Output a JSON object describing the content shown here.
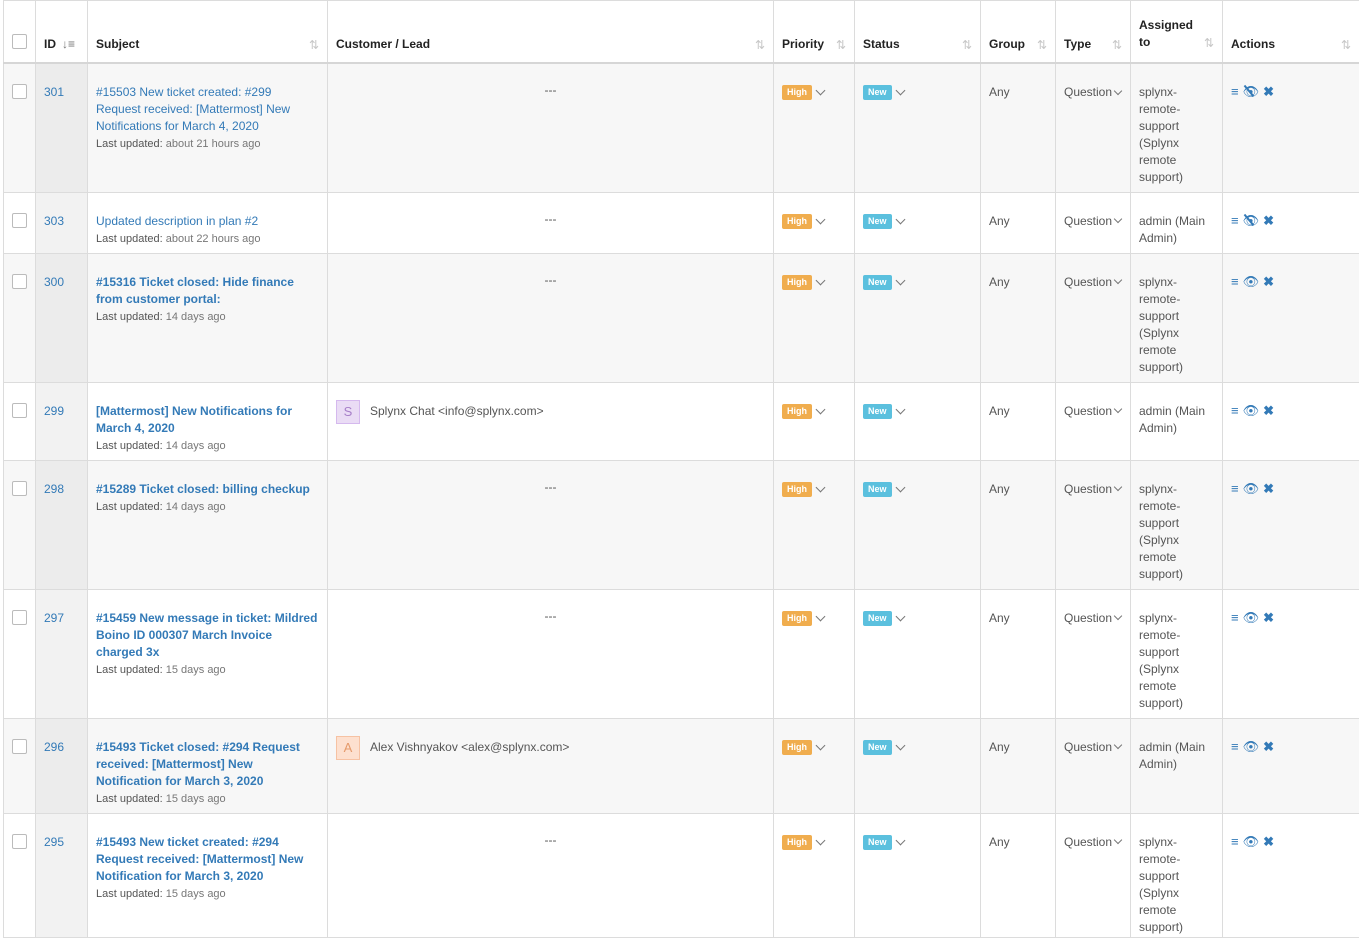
{
  "columns": {
    "id": "ID",
    "subject": "Subject",
    "customer": "Customer / Lead",
    "priority": "Priority",
    "status": "Status",
    "group": "Group",
    "type": "Type",
    "assigned": "Assigned to",
    "actions": "Actions"
  },
  "labels": {
    "last_updated": "Last updated:",
    "empty_customer": "---"
  },
  "rows": [
    {
      "id": "301",
      "subject": "#15503 New ticket created: #299 Request received: [Mattermost] New Notifications for March 4, 2020",
      "bold": false,
      "updated": "about 21 hours ago",
      "customer": null,
      "priority": "High",
      "status": "New",
      "group": "Any",
      "type": "Question",
      "assigned": "splynx-remote-support (Splynx remote support)",
      "view_icon": "eye-slash-icon"
    },
    {
      "id": "303",
      "subject": "Updated description in plan #2",
      "bold": false,
      "updated": "about 22 hours ago",
      "customer": null,
      "priority": "High",
      "status": "New",
      "group": "Any",
      "type": "Question",
      "assigned": "admin (Main Admin)",
      "view_icon": "eye-slash-icon"
    },
    {
      "id": "300",
      "subject": "#15316 Ticket closed: Hide finance from customer portal:",
      "bold": true,
      "updated": "14 days ago",
      "customer": null,
      "priority": "High",
      "status": "New",
      "group": "Any",
      "type": "Question",
      "assigned": "splynx-remote-support (Splynx remote support)",
      "view_icon": "eye-icon"
    },
    {
      "id": "299",
      "subject": "[Mattermost] New Notifications for March 4, 2020",
      "bold": true,
      "updated": "14 days ago",
      "customer": {
        "initial": "S",
        "name": "Splynx Chat <info@splynx.com>",
        "bg": "#eadcf5",
        "border": "#d5b9ee",
        "color": "#a77fc9"
      },
      "priority": "High",
      "status": "New",
      "group": "Any",
      "type": "Question",
      "assigned": "admin (Main Admin)",
      "view_icon": "eye-icon"
    },
    {
      "id": "298",
      "subject": "#15289 Ticket closed: billing checkup",
      "bold": true,
      "updated": "14 days ago",
      "customer": null,
      "priority": "High",
      "status": "New",
      "group": "Any",
      "type": "Question",
      "assigned": "splynx-remote-support (Splynx remote support)",
      "view_icon": "eye-icon"
    },
    {
      "id": "297",
      "subject": "#15459 New message in ticket: Mildred Boino ID 000307 March Invoice charged 3x",
      "bold": true,
      "updated": "15 days ago",
      "customer": null,
      "priority": "High",
      "status": "New",
      "group": "Any",
      "type": "Question",
      "assigned": "splynx-remote-support (Splynx remote support)",
      "view_icon": "eye-icon"
    },
    {
      "id": "296",
      "subject": "#15493 Ticket closed: #294 Request received: [Mattermost] New Notification for March 3, 2020",
      "bold": true,
      "updated": "15 days ago",
      "customer": {
        "initial": "A",
        "name": "Alex Vishnyakov <alex@splynx.com>",
        "bg": "#fde0cf",
        "border": "#f6c2a3",
        "color": "#e59a6b"
      },
      "priority": "High",
      "status": "New",
      "group": "Any",
      "type": "Question",
      "assigned": "admin (Main Admin)",
      "view_icon": "eye-icon"
    },
    {
      "id": "295",
      "subject": "#15493 New ticket created: #294 Request received: [Mattermost] New Notification for March 3, 2020",
      "bold": true,
      "updated": "15 days ago",
      "customer": null,
      "priority": "High",
      "status": "New",
      "group": "Any",
      "type": "Question",
      "assigned": "splynx-remote-support (Splynx remote support)",
      "view_icon": "eye-icon"
    }
  ],
  "colors": {
    "link": "#337ab7",
    "high": "#f0ad4e",
    "new": "#5bc0de"
  }
}
